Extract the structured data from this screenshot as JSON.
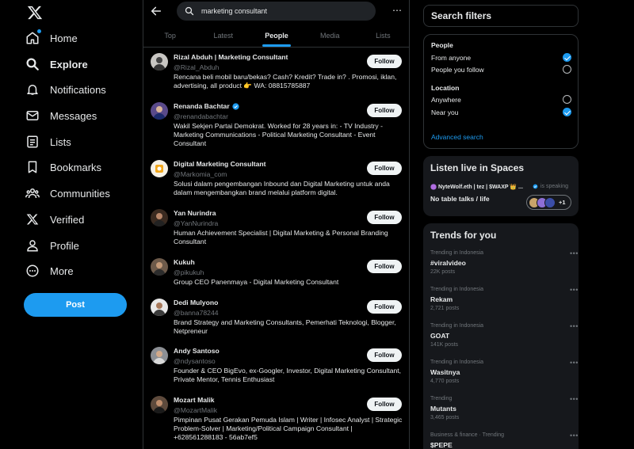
{
  "nav": {
    "items": [
      {
        "label": "Home",
        "icon": "home-icon"
      },
      {
        "label": "Explore",
        "icon": "search-icon"
      },
      {
        "label": "Notifications",
        "icon": "bell-icon"
      },
      {
        "label": "Messages",
        "icon": "envelope-icon"
      },
      {
        "label": "Lists",
        "icon": "list-icon"
      },
      {
        "label": "Bookmarks",
        "icon": "bookmark-icon"
      },
      {
        "label": "Communities",
        "icon": "people-icon"
      },
      {
        "label": "Verified",
        "icon": "x-logo-icon"
      },
      {
        "label": "Profile",
        "icon": "person-icon"
      },
      {
        "label": "More",
        "icon": "more-circle-icon"
      }
    ],
    "active": "Explore",
    "post_label": "Post"
  },
  "search": {
    "query": "marketing consultant"
  },
  "tabs": [
    "Top",
    "Latest",
    "People",
    "Media",
    "Lists"
  ],
  "active_tab": "People",
  "results": [
    {
      "name": "Rizal Abduh | Marketing Consultant",
      "handle": "@Rizal_Abduh",
      "bio": "Rencana beli mobil baru/bekas? Cash? Kredit? Trade in? . Promosi, iklan, advertising, all product 👉 WA: 08815785887",
      "verified": false,
      "follow": "Follow"
    },
    {
      "name": "Renanda Bachtar",
      "handle": "@renandabachtar",
      "bio": "Wakil Sekjen Partai Demokrat. Worked for 28 years in: - TV Industry - Marketing Communications - Political Marketing Consultant - Event Consultant",
      "verified": true,
      "follow": "Follow"
    },
    {
      "name": "Digital Marketing Consultant",
      "handle": "@Markomia_com",
      "bio": "Solusi dalam pengembangan Inbound dan Digital Marketing untuk anda dalam mengembangkan brand melalui platform digital.",
      "verified": false,
      "follow": "Follow"
    },
    {
      "name": "Yan Nurindra",
      "handle": "@YanNurindra",
      "bio": "Human Achievement Specialist | Digital Marketing & Personal Branding Consultant",
      "verified": false,
      "follow": "Follow"
    },
    {
      "name": "Kukuh",
      "handle": "@pikukuh",
      "bio": "Group CEO Panenmaya - Digital Marketing Consultant",
      "verified": false,
      "follow": "Follow"
    },
    {
      "name": "Dedi Mulyono",
      "handle": "@banna78244",
      "bio": "Brand Strategy and Marketing Consultants, Pemerhati Teknologi, Blogger, Netpreneur",
      "verified": false,
      "follow": "Follow"
    },
    {
      "name": "Andy Santoso",
      "handle": "@ndysantoso",
      "bio": "Founder & CEO BigEvo, ex-Googler, Investor, Digital Marketing Consultant, Private Mentor, Tennis Enthusiast",
      "verified": false,
      "follow": "Follow"
    },
    {
      "name": "Mozart Malik",
      "handle": "@MozartMalik",
      "bio": "Pimpinan Pusat Gerakan Pemuda Islam | Writer | Infosec Analyst | Strategic Problem-Solver | Marketing/Political Campaign Consultant | +628561288183 - 56ab7ef5",
      "verified": false,
      "follow": "Follow"
    }
  ],
  "filters": {
    "title": "Search filters",
    "people_heading": "People",
    "people_options": [
      "From anyone",
      "People you follow"
    ],
    "people_selected": 0,
    "location_heading": "Location",
    "location_options": [
      "Anywhere",
      "Near you"
    ],
    "location_selected": 1,
    "advanced": "Advanced search"
  },
  "spaces": {
    "title": "Listen live in Spaces",
    "host": "NyteWolf.eth | tez | $WAXP 👑 ...",
    "speaking": "is speaking",
    "topic": "No table talks / life",
    "extra_count": "+1"
  },
  "trends": {
    "title": "Trends for you",
    "items": [
      {
        "context": "Trending in Indonesia",
        "name": "#viralvideo",
        "count": "22K posts"
      },
      {
        "context": "Trending in Indonesia",
        "name": "Rekam",
        "count": "2,721 posts"
      },
      {
        "context": "Trending in Indonesia",
        "name": "GOAT",
        "count": "141K posts"
      },
      {
        "context": "Trending in Indonesia",
        "name": "Wasitnya",
        "count": "4,770 posts"
      },
      {
        "context": "Trending",
        "name": "Mutants",
        "count": "3,465 posts"
      },
      {
        "context": "Business & finance · Trending",
        "name": "$PEPE",
        "count": ""
      }
    ]
  },
  "colors": {
    "accent": "#1d9bf0",
    "background": "#000000",
    "panel": "#16181c",
    "border": "#2f3336",
    "muted": "#71767b"
  }
}
